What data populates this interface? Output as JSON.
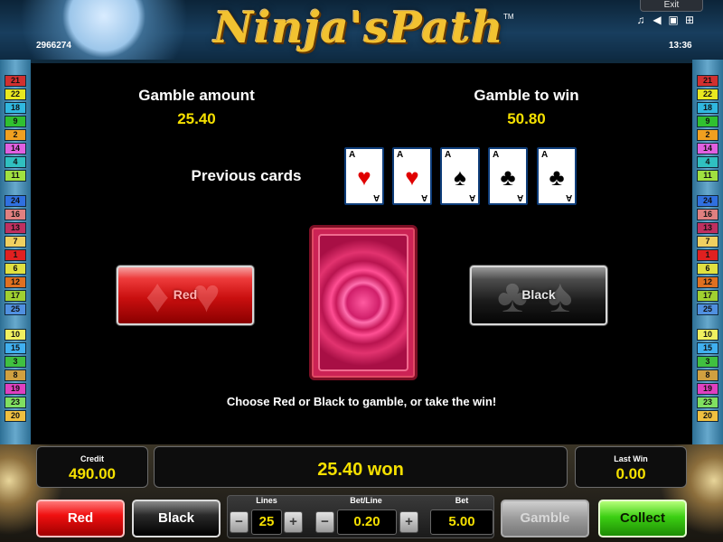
{
  "header": {
    "logo": "Ninja'sPath",
    "trademark": "TM",
    "session_id": "2966274",
    "clock": "13:36",
    "exit_label": "Exit",
    "icons": [
      "music-icon",
      "speaker-icon",
      "window-icon",
      "grid-icon"
    ]
  },
  "side_lines": {
    "left": [
      "21",
      "22",
      "18",
      "9",
      "2",
      "14",
      "4",
      "11",
      "24",
      "16",
      "13",
      "7",
      "1",
      "6",
      "12",
      "17",
      "25",
      "10",
      "15",
      "3",
      "8",
      "19",
      "23",
      "20"
    ],
    "right": [
      "21",
      "22",
      "18",
      "9",
      "2",
      "14",
      "4",
      "11",
      "24",
      "16",
      "13",
      "7",
      "1",
      "6",
      "12",
      "17",
      "25",
      "10",
      "15",
      "3",
      "8",
      "19",
      "23",
      "20"
    ],
    "colors": [
      "#d23030",
      "#e8e820",
      "#30b8e0",
      "#30c030",
      "#f0a020",
      "#e060e0",
      "#30c0c0",
      "#a0e040",
      "#3070e0",
      "#e08080",
      "#c03060",
      "#f0d060",
      "#e02020",
      "#e0e040",
      "#e07020",
      "#a0d030",
      "#5090e0",
      "#f0f060",
      "#40b0f0",
      "#40c040",
      "#d0a040",
      "#e040c0",
      "#80e060",
      "#f0c040"
    ]
  },
  "gamble": {
    "amount_label": "Gamble amount",
    "amount_value": "25.40",
    "to_win_label": "Gamble to win",
    "to_win_value": "50.80",
    "previous_label": "Previous cards",
    "previous_cards": [
      {
        "rank": "A",
        "suit": "♥",
        "color": "#e00000"
      },
      {
        "rank": "A",
        "suit": "♥",
        "color": "#e00000"
      },
      {
        "rank": "A",
        "suit": "♠",
        "color": "#000000"
      },
      {
        "rank": "A",
        "suit": "♣",
        "color": "#000000"
      },
      {
        "rank": "A",
        "suit": "♣",
        "color": "#000000"
      }
    ],
    "red_choice_label": "Red",
    "black_choice_label": "Black",
    "instruction": "Choose Red or Black to gamble, or take the win!"
  },
  "bottom": {
    "credit_label": "Credit",
    "credit_value": "490.00",
    "win_message": "25.40 won",
    "last_win_label": "Last Win",
    "last_win_value": "0.00",
    "red_button": "Red",
    "black_button": "Black",
    "lines_label": "Lines",
    "lines_value": "25",
    "bet_line_label": "Bet/Line",
    "bet_line_value": "0.20",
    "bet_label": "Bet",
    "bet_value": "5.00",
    "gamble_button": "Gamble",
    "collect_button": "Collect",
    "minus": "−",
    "plus": "+"
  }
}
